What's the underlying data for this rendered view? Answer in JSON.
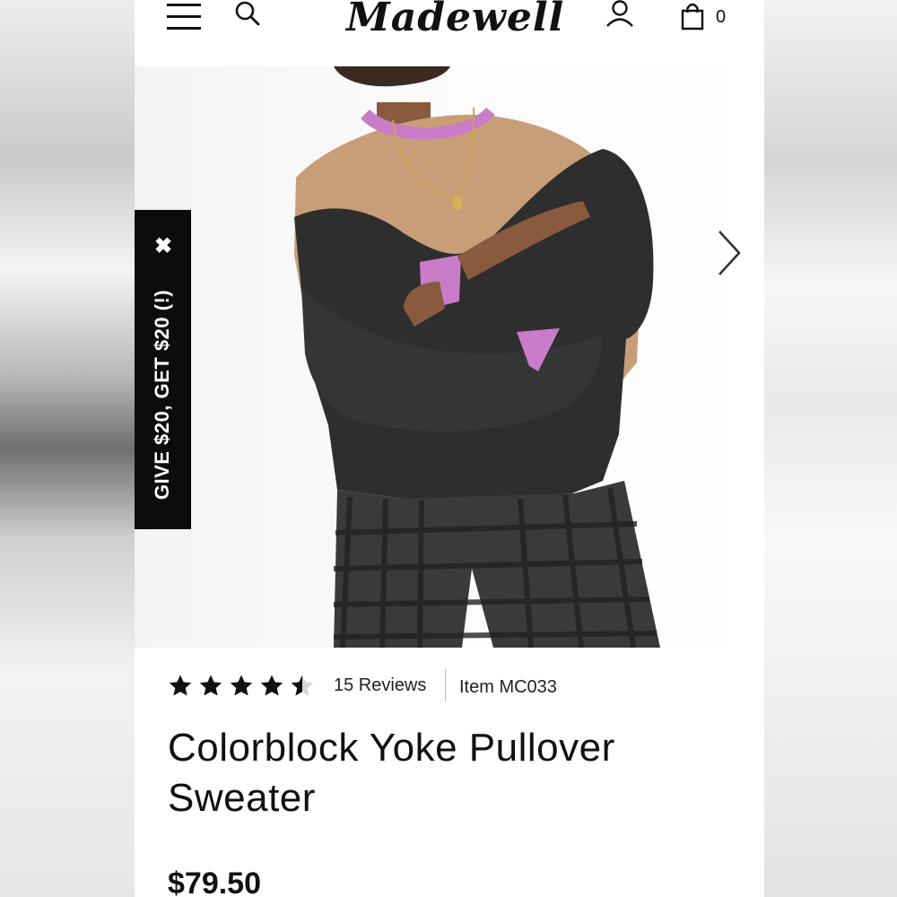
{
  "header": {
    "brand": "Madewell",
    "bag_count": "0",
    "icons": [
      "menu-icon",
      "search-icon",
      "account-icon",
      "shopping-bag-icon"
    ]
  },
  "promo": {
    "text": "GIVE $20, GET $20 (!)",
    "close_symbol": "✖"
  },
  "product": {
    "rating": 4.5,
    "reviews_label": "15 Reviews",
    "item_label": "Item MC033",
    "title": "Colorblock Yoke Pullover Sweater",
    "price": "$79.50",
    "colors": {
      "charcoal": "#2e2e2e",
      "camel": "#c89e78",
      "pink": "#c97cc8",
      "plaid": "#3a3a3a"
    }
  }
}
